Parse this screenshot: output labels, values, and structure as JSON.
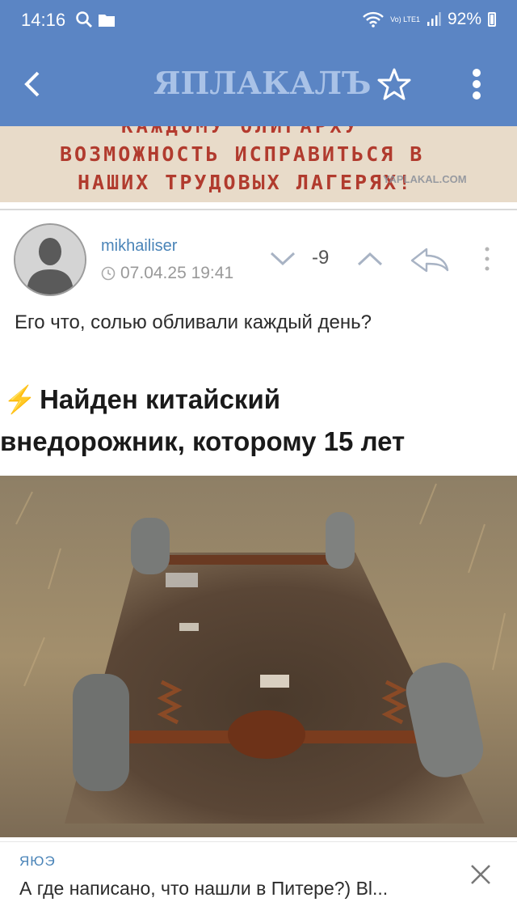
{
  "status_bar": {
    "time": "14:16",
    "network_label": "Vo) LTE1",
    "battery": "92%"
  },
  "header": {
    "logo": "ЯПЛАКАЛЪ",
    "icons": [
      "back-arrow-icon",
      "star-icon",
      "more-vertical-icon"
    ],
    "color": "#5b85c4"
  },
  "banner": {
    "line_partial": "КАЖДОМУ ОЛИГАРХУ",
    "line1": "ВОЗМОЖНОСТЬ ИСПРАВИТЬСЯ В",
    "line2": "НАШИХ ТРУДОВЫХ ЛАГЕРЯХ!",
    "watermark": "YAPLAKAL.COM"
  },
  "comment": {
    "author": "mikhailiser",
    "date": "07.04.25 19:41",
    "score": "-9",
    "text": "Его что, солью обливали каждый день?",
    "embed": {
      "caption_line1": "Найден китайский",
      "caption_line2": "внедорожник, которому 15 лет",
      "image": "rusted-car-chassis-photo"
    }
  },
  "reply_preview": {
    "author": "ЯЮЭ",
    "text": "А где написано, что нашли в Питере?) Вl..."
  }
}
